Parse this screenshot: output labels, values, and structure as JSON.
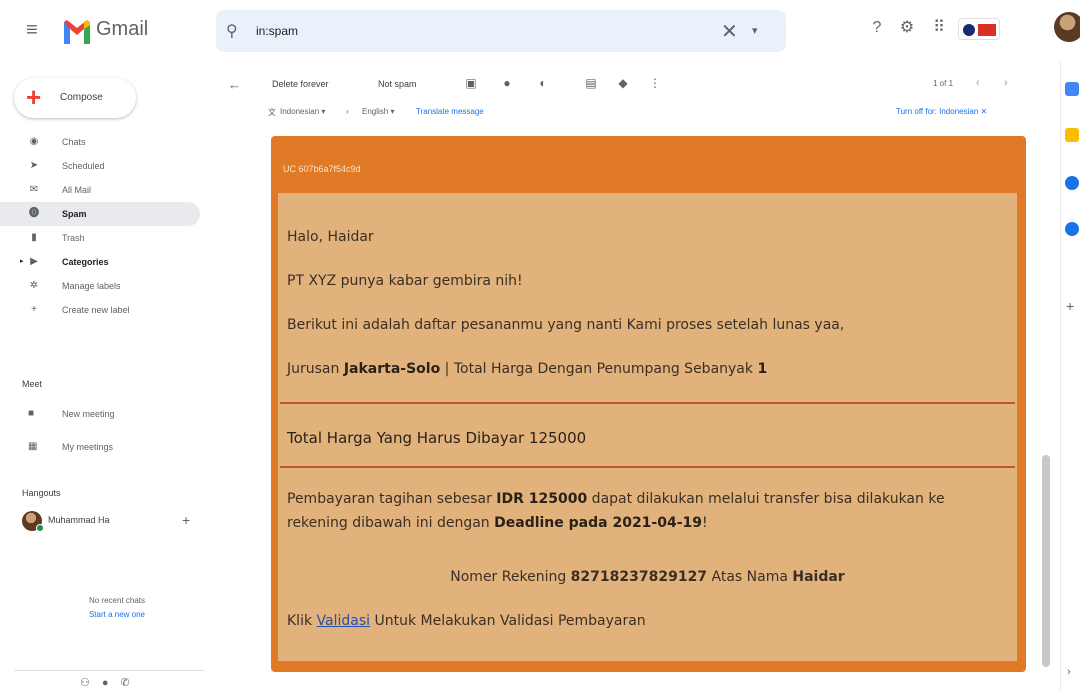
{
  "app": {
    "name": "Gmail"
  },
  "search": {
    "value": "in:spam",
    "clear_glyph": "✕",
    "options_glyph": "▾"
  },
  "compose": {
    "label": "Compose"
  },
  "sidebar": {
    "items": [
      {
        "label": "Chats",
        "icon": "chats-icon",
        "glyph": "◉"
      },
      {
        "label": "Scheduled",
        "icon": "scheduled-icon",
        "glyph": "➤"
      },
      {
        "label": "All Mail",
        "icon": "all-mail-icon",
        "glyph": "✉"
      },
      {
        "label": "Spam",
        "icon": "spam-icon",
        "glyph": "⓿"
      },
      {
        "label": "Trash",
        "icon": "trash-icon",
        "glyph": "▮"
      },
      {
        "label": "Categories",
        "icon": "label-icon",
        "glyph": "▶"
      },
      {
        "label": "Manage labels",
        "icon": "gear-icon",
        "glyph": "✲"
      },
      {
        "label": "Create new label",
        "icon": "plus-icon",
        "glyph": "+"
      }
    ],
    "meet": {
      "title": "Meet",
      "new_meeting": "New meeting",
      "my_meetings": "My meetings"
    },
    "hangouts": {
      "title": "Hangouts",
      "user": "Muhammad Ha",
      "no_chats": "No recent chats",
      "start_new": "Start a new one"
    }
  },
  "toolbar": {
    "delete_forever": "Delete forever",
    "not_spam": "Not spam",
    "count": "1 of 1"
  },
  "translate": {
    "from": "Indonesian ▾",
    "arrow": "›",
    "to": "English ▾",
    "translate_message": "Translate message",
    "turn_off": "Turn off for: Indonesian ✕"
  },
  "email": {
    "header": "UC 607b6a7f54c9d",
    "greeting": "Halo, Haidar",
    "line1": "PT XYZ punya kabar gembira nih!",
    "line2": "Berikut ini adalah daftar pesananmu yang nanti Kami proses setelah lunas yaa,",
    "route_prefix": "Jurusan ",
    "route": "Jakarta-Solo",
    "route_mid": " | Total Harga Dengan Penumpang Sebanyak ",
    "passengers": "1",
    "total": "Total Harga Yang Harus Dibayar 125000",
    "pay_prefix": "Pembayaran tagihan sebesar ",
    "pay_amount": "IDR 125000",
    "pay_mid": " dapat dilakukan melalui transfer bisa dilakukan ke rekening dibawah ini dengan ",
    "deadline": "Deadline pada 2021-04-19",
    "pay_suffix": "!",
    "account_prefix": "Nomer Rekening ",
    "account_number": "82718237829127",
    "account_mid": " Atas Nama ",
    "account_name": "Haidar",
    "click_prefix": "Klik ",
    "validasi_link": "Validasi",
    "click_suffix": " Untuk Melakukan Validasi Pembayaran"
  },
  "colors": {
    "email_outer": "#e07a26",
    "email_inner": "#e2b27d",
    "rule": "#c0562f",
    "accent_blue": "#1a73e8"
  }
}
